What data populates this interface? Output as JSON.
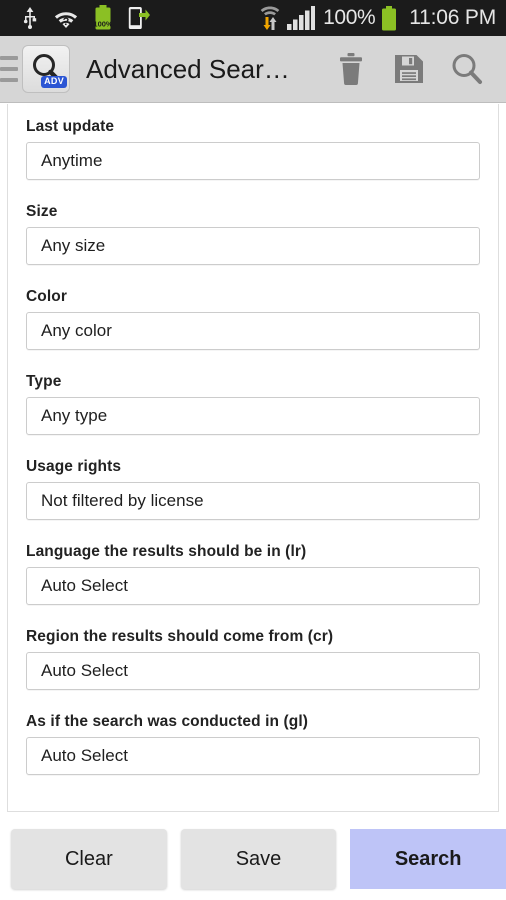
{
  "status_bar": {
    "left_icons": [
      "usb-icon",
      "wifi-unknown-icon",
      "battery-full-icon",
      "phone-transfer-icon"
    ],
    "battery_label": "100%",
    "battery_percent_badge": "100%",
    "signal_label": "100%",
    "clock": "11:06 PM",
    "colors": {
      "background": "#1b1b1b",
      "text": "#e6e6e6",
      "battery_green": "#8bc024",
      "accent_orange": "#f0a500"
    }
  },
  "app_bar": {
    "title": "Advanced Sear…",
    "icon_badge": "ADV",
    "actions": [
      {
        "name": "delete",
        "icon": "trash-icon"
      },
      {
        "name": "save",
        "icon": "floppy-disk-icon"
      },
      {
        "name": "search",
        "icon": "magnifier-icon"
      }
    ],
    "colors": {
      "background": "#d6d6d6",
      "icon": "#7b7b7b",
      "title": "#1a1a1a"
    }
  },
  "form": {
    "fields": [
      {
        "label": "Last update",
        "value": "Anytime"
      },
      {
        "label": "Size",
        "value": "Any size"
      },
      {
        "label": "Color",
        "value": "Any color"
      },
      {
        "label": "Type",
        "value": "Any type"
      },
      {
        "label": "Usage rights",
        "value": "Not filtered by license"
      },
      {
        "label": "Language the results should be in (lr)",
        "value": "Auto Select"
      },
      {
        "label": "Region the results should come from (cr)",
        "value": "Auto Select"
      },
      {
        "label": "As if the search was conducted in (gl)",
        "value": "Auto Select"
      }
    ]
  },
  "buttons": {
    "clear_label": "Clear",
    "save_label": "Save",
    "search_label": "Search",
    "primary_color": "#bec4f7",
    "secondary_color": "#e3e3e3"
  }
}
